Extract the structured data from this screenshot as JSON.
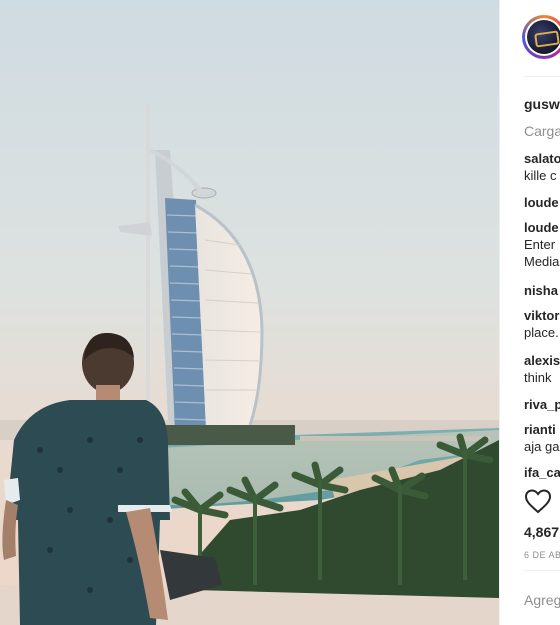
{
  "post": {
    "image_alt": "Man sitting on a ledge looking at the Burj Al Arab hotel at sunset"
  },
  "sidebar": {
    "username": "guswi",
    "loading_text": "Carga",
    "comments": [
      {
        "user": "salato",
        "text": "kille c"
      },
      {
        "user": "loude",
        "text": ""
      },
      {
        "user": "loude",
        "text": "Enter",
        "text2": "Media"
      },
      {
        "user": "nisha",
        "text": ""
      },
      {
        "user": "viktor",
        "text": "place."
      },
      {
        "user": "alexis",
        "text": "think"
      },
      {
        "user": "riva_p",
        "text": ""
      },
      {
        "user": "rianti",
        "text": "aja ga"
      },
      {
        "user": "ifa_ca",
        "text": ""
      }
    ],
    "likes": "4,867",
    "date": "6 DE AB",
    "add_comment_placeholder": "Agreg"
  },
  "icons": {
    "like": "heart-outline-icon"
  }
}
